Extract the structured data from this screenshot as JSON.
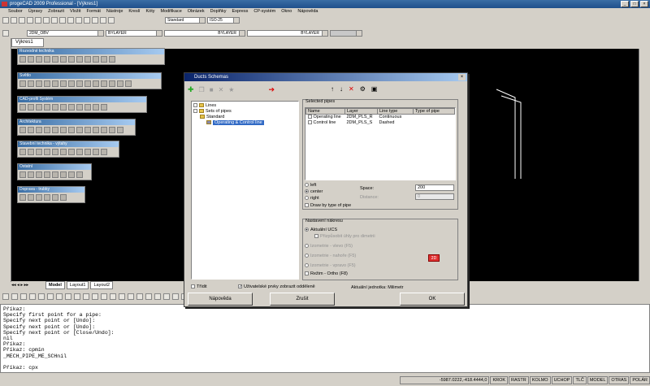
{
  "app": {
    "title": "progeCAD 2009 Professional - [Výkres1]",
    "win_min": "_",
    "win_max": "□",
    "win_close": "×"
  },
  "menu": [
    "Soubor",
    "Úpravy",
    "Zobrazit",
    "Vložit",
    "Formát",
    "Nástroje",
    "Kreslí",
    "Kóty",
    "Modifikace",
    "Obrázek",
    "Doplňky",
    "Express",
    "CP-systém",
    "Okno",
    "Nápověda"
  ],
  "toolbar2": {
    "style": "Standard",
    "dimstyle": "ISO-25"
  },
  "toolbar3": {
    "layer": "2DM_OBV",
    "color": "BYLAYER",
    "linetype": "BYLAYER",
    "lineweight": "BYLAYER"
  },
  "doc_tab": "Výkres1",
  "floating_toolbars": [
    {
      "title": "Rozvodné technika",
      "icons": 12
    },
    {
      "title": "Světlo",
      "icons": 14
    },
    {
      "title": "CAD-profil Systém",
      "icons": 11
    },
    {
      "title": "Architektura",
      "icons": 13
    },
    {
      "title": "Stavební technika - výtahy",
      "icons": 11
    },
    {
      "title": "Ostatní",
      "icons": 8
    },
    {
      "title": "Doprava - trubky",
      "icons": 6
    }
  ],
  "model_tabs": [
    "Model",
    "Layout1",
    "Layout2"
  ],
  "dialog": {
    "title": "Ducts Schemas",
    "tree": [
      "Lines",
      "Sets of pipes",
      "Standard",
      "Operating & Control line"
    ],
    "selected_pipes_label": "Selected pipes",
    "columns": [
      "Name",
      "Layer",
      "Line type",
      "Type of pipe"
    ],
    "rows": [
      [
        "Operating line",
        "2DM_PLS_R",
        "Continuous",
        ""
      ],
      [
        "Control line",
        "2DM_PLS_S",
        "Dashed",
        ""
      ]
    ],
    "align": {
      "left": "left",
      "center": "center",
      "right": "right",
      "space_label": "Space:",
      "space_value": "200",
      "distance_label": "Distance:",
      "distance_value": "0"
    },
    "draw_by_type": "Draw by type of pipe",
    "group_title": "Nastavení nákresu",
    "ucs": "Aktuální UCS",
    "ucs_sub": "Přizpůsobit úhly pro dimetrii",
    "iso1": "Izometrie - vlevo (F5)",
    "iso2": "Izometrie - nahoře (F5)",
    "iso3": "Izometrie - vpravo (F5)",
    "ortho": "Režim - Ortho (F8)",
    "badge": "2D",
    "tridit": "Třídit",
    "user_elements": "Uživatelské prvky zobrazit odděleně",
    "units": "Aktuální jednotka: Milimetr",
    "help_btn": "Nápověda",
    "cancel_btn": "Zrušit",
    "ok_btn": "OK"
  },
  "command_lines": [
    "Příkaz:",
    "Specify first point for a pipe:",
    "Specify next point or [Undo]:",
    "Specify next point or [Undo]:",
    "Specify next point or [Close/Undo]:",
    "nil",
    "Příkaz:",
    "Příkaz: cpmin",
    "_MECH_PIPE_ME_SCHnil",
    "",
    "Příkaz: cpx"
  ],
  "status": {
    "coords": "-5987.0222,-418.4444,0",
    "items": [
      "KROK",
      "RASTR",
      "KOLMO",
      "UCHOP",
      "TLČ",
      "MODEL",
      "OTRAS",
      "POLÁR"
    ]
  }
}
